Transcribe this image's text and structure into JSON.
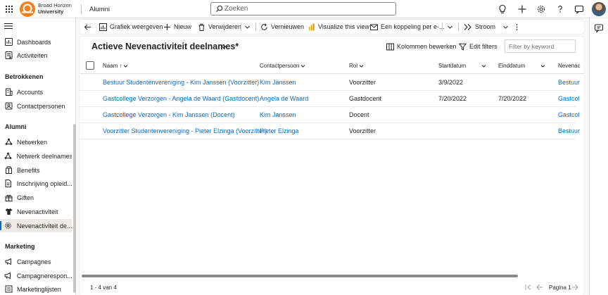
{
  "org": {
    "line1": "Broad Horizon",
    "line2": "University"
  },
  "app": {
    "name": "Alumni"
  },
  "search": {
    "placeholder": "Zoeken"
  },
  "topbar_icons": [
    "lightbulb-icon",
    "plus-icon",
    "gear-icon",
    "help-icon",
    "chat-icon"
  ],
  "colors": {
    "accent": "#0f6cbd",
    "logo": "#f27f1b",
    "link": "#0f6cbd"
  },
  "sidebar": {
    "pinned": [
      {
        "label": "Dashboards",
        "icon": "dashboard-icon"
      },
      {
        "label": "Activiteiten",
        "icon": "activities-icon"
      }
    ],
    "sections": [
      {
        "title": "Betrokkenen",
        "items": [
          {
            "label": "Accounts",
            "icon": "building-icon"
          },
          {
            "label": "Contactpersonen",
            "icon": "contact-icon"
          }
        ]
      },
      {
        "title": "Alumni",
        "items": [
          {
            "label": "Netwerken",
            "icon": "network-icon"
          },
          {
            "label": "Netwerk deelnames",
            "icon": "network-icon"
          },
          {
            "label": "Benefits",
            "icon": "benefits-icon"
          },
          {
            "label": "Inschrijving opleid...",
            "icon": "document-icon"
          },
          {
            "label": "Giften",
            "icon": "gift-icon"
          },
          {
            "label": "Nevenactiviteit",
            "icon": "shirt-icon"
          },
          {
            "label": "Nevenactiviteit de...",
            "icon": "gear-icon",
            "selected": true
          }
        ]
      },
      {
        "title": "Marketing",
        "items": [
          {
            "label": "Campagnes",
            "icon": "megaphone-icon"
          },
          {
            "label": "Campagnerespon...",
            "icon": "megaphone-icon"
          },
          {
            "label": "Marketinglijsten",
            "icon": "list-icon"
          }
        ]
      }
    ]
  },
  "commandbar": {
    "back": "back-arrow-icon",
    "show_chart": "Grafiek weergeven",
    "new": "Nieuw",
    "delete": "Verwijderen",
    "refresh": "Vernieuwen",
    "visualize": "Visualize this view",
    "email_link": "Een koppeling per e-...",
    "flow": "Stroom"
  },
  "view": {
    "title": "Actieve Nevenactiviteit deelnames*",
    "edit_columns": "Kolommen bewerken",
    "edit_filters": "Edit filters",
    "keyword_placeholder": "Filter by keyword"
  },
  "grid": {
    "columns": [
      "Naam",
      "Contactpersoon",
      "Rol",
      "Startdatum",
      "Einddatum",
      "Nevenac"
    ],
    "sort": {
      "column": "Naam",
      "direction": "ascending"
    },
    "rows": [
      {
        "name": "Bestuur Studentenvereniging - Kim Janssen (Voorzitter)",
        "contact": "Kim Janssen",
        "role": "Voorzitter",
        "start": "3/9/2022",
        "end": "",
        "activity": "Bestuur"
      },
      {
        "name": "Gastcollege Verzorgen - Angela de Waard (Gastdocent)",
        "contact": "Angela de Waard",
        "role": "Gastdocent",
        "start": "7/20/2022",
        "end": "7/20/2022",
        "activity": "Gastcol"
      },
      {
        "name": "Gastcollege Verzorgen - Kim Janssen (Docent)",
        "contact": "Kim Janssen",
        "role": "Docent",
        "start": "",
        "end": "",
        "activity": "Gastcol"
      },
      {
        "name": "Voorzitter Studentenvereniging - Pieter Elzinga (Voorzitter)",
        "contact": "Pieter Elzinga",
        "role": "Voorzitter",
        "start": "",
        "end": "",
        "activity": "Bestuur"
      }
    ],
    "record_count": "1 - 4 van 4",
    "page_label": "Pagina 1"
  }
}
